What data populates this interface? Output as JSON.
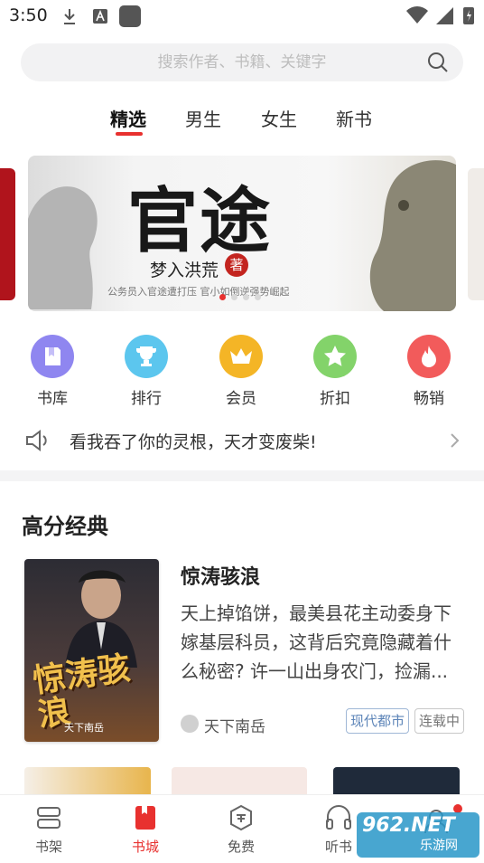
{
  "status_bar": {
    "time": "3:50"
  },
  "search": {
    "placeholder": "搜索作者、书籍、关键字"
  },
  "tabs": [
    {
      "label": "精选",
      "active": true
    },
    {
      "label": "男生",
      "active": false
    },
    {
      "label": "女生",
      "active": false
    },
    {
      "label": "新书",
      "active": false
    }
  ],
  "banner": {
    "title": "官途",
    "author": "梦入洪荒",
    "badge": "著",
    "tagline": "公务员入官途遭打压 官小如倒逆强势崛起",
    "slide_count": 4,
    "active_slide": 1
  },
  "shortcuts": [
    {
      "label": "书库",
      "icon": "book-library-icon",
      "color": "#8f86f0"
    },
    {
      "label": "排行",
      "icon": "trophy-icon",
      "color": "#5cc6ee"
    },
    {
      "label": "会员",
      "icon": "crown-icon",
      "color": "#f4b526"
    },
    {
      "label": "折扣",
      "icon": "star-icon",
      "color": "#83d36a"
    },
    {
      "label": "畅销",
      "icon": "flame-icon",
      "color": "#f25b5b"
    }
  ],
  "notice": {
    "text": "看我吞了你的灵根，天才变废柴!"
  },
  "section": {
    "title": "高分经典",
    "featured": {
      "title": "惊涛骇浪",
      "cover_title": "惊涛骇浪",
      "cover_author": "天下南岳",
      "description": "天上掉馅饼，最美县花主动委身下嫁基层科员，这背后究竟隐藏着什么秘密? 许一山出身农门，捡漏...",
      "author": "天下南岳",
      "tags": [
        "现代都市",
        "连载中"
      ]
    }
  },
  "bottom_nav": [
    {
      "label": "书架",
      "icon": "bookshelf-icon",
      "active": false
    },
    {
      "label": "书城",
      "icon": "bookstore-icon",
      "active": true
    },
    {
      "label": "免费",
      "icon": "free-icon",
      "active": false
    },
    {
      "label": "听书",
      "icon": "headphones-icon",
      "active": false
    }
  ],
  "watermark": {
    "number": "962.NET",
    "site": "乐游网"
  },
  "colors": {
    "accent": "#e8312f"
  }
}
